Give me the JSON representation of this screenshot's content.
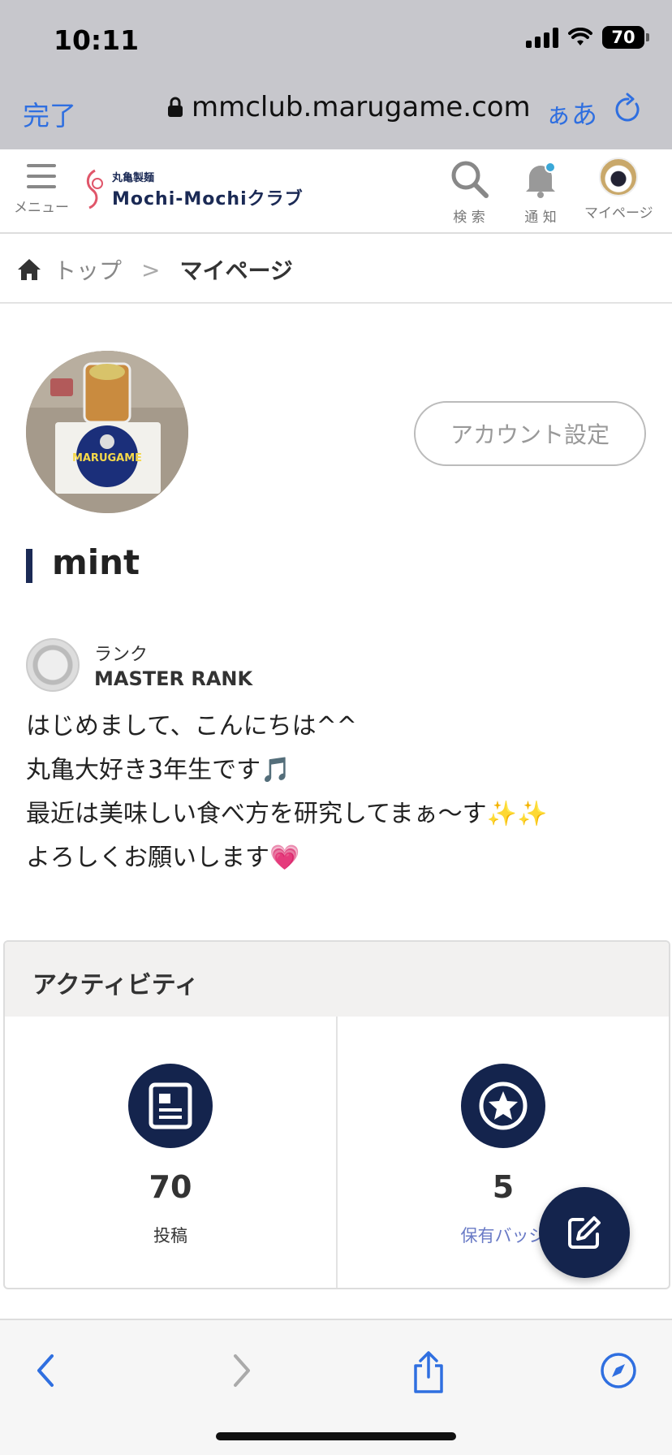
{
  "status": {
    "time": "10:11",
    "battery": "70"
  },
  "safari": {
    "done_label": "完了",
    "url": "mmclub.marugame.com",
    "text_size_label": "ぁあ"
  },
  "header": {
    "menu_label": "メニュー",
    "logo_sub": "丸亀製麺",
    "logo_main": "Mochi-Mochiクラブ",
    "search_label": "検 索",
    "notify_label": "通 知",
    "mypage_label": "マイページ"
  },
  "breadcrumb": {
    "top": "トップ",
    "separator": ">",
    "current": "マイページ"
  },
  "profile": {
    "account_settings": "アカウント設定",
    "username": "mint",
    "rank_label": "ランク",
    "rank_value": "MASTER RANK",
    "bio": [
      "はじめまして、こんにちは^^",
      "丸亀大好き3年生です🎵",
      "最近は美味しい食べ方を研究してまぁ〜す✨✨",
      "よろしくお願いします💗"
    ]
  },
  "activity": {
    "title": "アクティビティ",
    "posts_count": "70",
    "posts_label": "投稿",
    "badges_count": "5",
    "badges_label": "保有バッジ"
  },
  "colors": {
    "navy": "#14244d",
    "ios_blue": "#2f6fe0",
    "link": "#6a7bc6"
  }
}
